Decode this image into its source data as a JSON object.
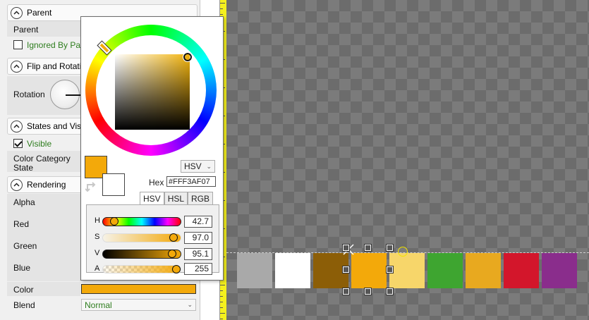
{
  "panel": {
    "parent_section": {
      "title": "Parent",
      "parent_label": "Parent",
      "ignored_label": "Ignored By Pare"
    },
    "flip_section": {
      "title": "Flip and Rotatio",
      "rotation_label": "Rotation"
    },
    "states_section": {
      "title": "States and Visib",
      "visible_label": "Visible",
      "category_label": "Color Category",
      "state_label": "State"
    },
    "rendering_section": {
      "title": "Rendering",
      "alpha_label": "Alpha",
      "red_label": "Red",
      "green_label": "Green",
      "blue_label": "Blue",
      "color_label": "Color",
      "blend_label": "Blend",
      "blend_value": "Normal"
    }
  },
  "picker": {
    "model_select": "HSV",
    "hex_label": "Hex",
    "hex_value": "#FFF3AF07",
    "tabs": [
      "HSV",
      "HSL",
      "RGB"
    ],
    "active_tab": "HSV",
    "channels": [
      {
        "label": "H",
        "value": "42.7"
      },
      {
        "label": "S",
        "value": "97.0"
      },
      {
        "label": "V",
        "value": "95.1"
      },
      {
        "label": "A",
        "value": "255"
      }
    ]
  },
  "colors": {
    "accent": "#f3a90a",
    "swatches": [
      "#a9a9a9",
      "#ffffff",
      "#8c5e07",
      "#f3a90a",
      "#f7d66a",
      "#3ea530",
      "#e8a91f",
      "#d3162b",
      "#8a2d8c"
    ]
  }
}
